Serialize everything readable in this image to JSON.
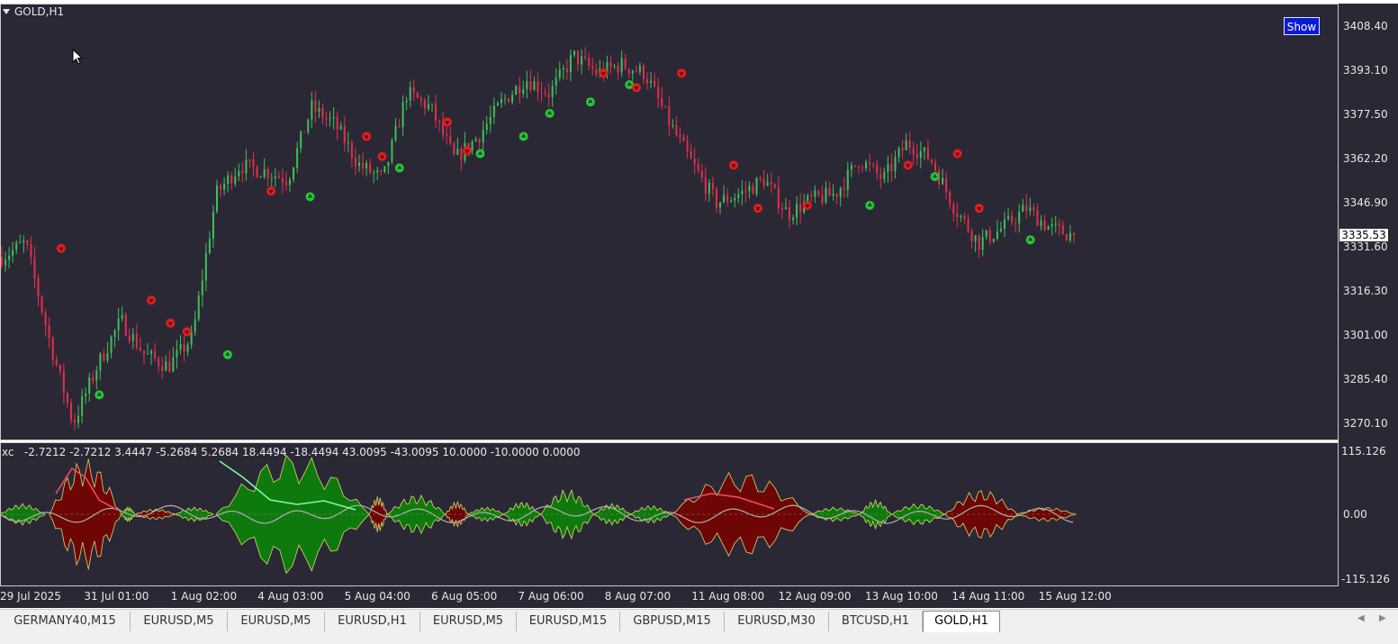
{
  "chart_title": "GOLD,H1",
  "show_button": "Show",
  "current_price": "3335.53",
  "price_axis": [
    "3408.40",
    "3393.10",
    "3377.50",
    "3362.20",
    "3346.90",
    "3331.60",
    "3316.30",
    "3301.00",
    "3285.40",
    "3270.10"
  ],
  "indicator": {
    "name": "xc",
    "values": "-2.7212 -2.7212 3.4447 -5.2684 5.2684 18.4494 -18.4494 43.0095 -43.0095 10.0000 -10.0000 0.0000",
    "axis": [
      "115.126",
      "0.00",
      "-115.126"
    ]
  },
  "time_axis": [
    "29 Jul 2025",
    "31 Jul 01:00",
    "1 Aug 02:00",
    "4 Aug 03:00",
    "5 Aug 04:00",
    "6 Aug 05:00",
    "7 Aug 06:00",
    "8 Aug 07:00",
    "11 Aug 08:00",
    "12 Aug 09:00",
    "13 Aug 10:00",
    "14 Aug 11:00",
    "15 Aug 12:00"
  ],
  "tabs": [
    "GERMANY40,M15",
    "EURUSD,M5",
    "EURUSD,M5",
    "EURUSD,H1",
    "EURUSD,M5",
    "EURUSD,M15",
    "GBPUSD,M15",
    "EURUSD,M30",
    "BTCUSD,H1",
    "GOLD,H1"
  ],
  "active_tab": "GOLD,H1",
  "colors": {
    "background": "#2b2836",
    "bull_candle": "#3fbf5a",
    "bear_candle": "#e0304a",
    "buy_arrow": "#28c23a",
    "sell_arrow": "#e01e1e",
    "fill_green": "#0e7a0e",
    "fill_red": "#6e0606",
    "show_button": "#0a1bd8"
  },
  "icons": [
    "dropdown-triangle-icon",
    "mouse-cursor-icon",
    "scroll-left-icon",
    "scroll-right-icon",
    "buy-arrow-icon",
    "sell-arrow-icon"
  ],
  "chart_data": {
    "type": "candlestick",
    "ylim": [
      3262,
      3412
    ],
    "x": [
      "29 Jul 2025",
      "31 Jul 01:00",
      "1 Aug 02:00",
      "4 Aug 03:00",
      "5 Aug 04:00",
      "6 Aug 05:00",
      "7 Aug 06:00",
      "8 Aug 07:00",
      "11 Aug 08:00",
      "12 Aug 09:00",
      "13 Aug 10:00",
      "14 Aug 11:00",
      "15 Aug 12:00"
    ],
    "path": [
      [
        "29 Jul 2025",
        3328
      ],
      [
        "30 Jul",
        3333
      ],
      [
        "30 Jul",
        3299
      ],
      [
        "31 Jul 01:00",
        3270
      ],
      [
        "31 Jul",
        3290
      ],
      [
        "31 Jul",
        3306
      ],
      [
        "1 Aug",
        3294
      ],
      [
        "1 Aug 02:00",
        3290
      ],
      [
        "1 Aug",
        3300
      ],
      [
        "1 Aug",
        3350
      ],
      [
        "1 Aug",
        3360
      ],
      [
        "4 Aug 03:00",
        3358
      ],
      [
        "4 Aug",
        3355
      ],
      [
        "4 Aug",
        3380
      ],
      [
        "5 Aug",
        3374
      ],
      [
        "5 Aug 04:00",
        3360
      ],
      [
        "5 Aug",
        3355
      ],
      [
        "5 Aug",
        3385
      ],
      [
        "6 Aug",
        3380
      ],
      [
        "6 Aug 05:00",
        3362
      ],
      [
        "6 Aug",
        3370
      ],
      [
        "7 Aug",
        3382
      ],
      [
        "7 Aug",
        3390
      ],
      [
        "7 Aug 06:00",
        3385
      ],
      [
        "8 Aug",
        3398
      ],
      [
        "8 Aug",
        3392
      ],
      [
        "8 Aug 07:00",
        3395
      ],
      [
        "8 Aug",
        3392
      ],
      [
        "8 Aug",
        3375
      ],
      [
        "11 Aug",
        3360
      ],
      [
        "11 Aug 08:00",
        3347
      ],
      [
        "11 Aug",
        3350
      ],
      [
        "12 Aug",
        3355
      ],
      [
        "12 Aug 09:00",
        3343
      ],
      [
        "12 Aug",
        3348
      ],
      [
        "13 Aug",
        3350
      ],
      [
        "13 Aug 10:00",
        3362
      ],
      [
        "13 Aug",
        3355
      ],
      [
        "13 Aug",
        3368
      ],
      [
        "14 Aug",
        3362
      ],
      [
        "14 Aug",
        3345
      ],
      [
        "14 Aug 11:00",
        3333
      ],
      [
        "14 Aug",
        3338
      ],
      [
        "15 Aug",
        3345
      ],
      [
        "15 Aug 12:00",
        3338
      ],
      [
        "15 Aug",
        3335.53
      ]
    ],
    "buy_signals": [
      [
        1.04,
        3280
      ],
      [
        2.52,
        3294
      ],
      [
        3.47,
        3349
      ],
      [
        4.5,
        3359
      ],
      [
        5.43,
        3364
      ],
      [
        5.93,
        3370
      ],
      [
        6.23,
        3378
      ],
      [
        6.7,
        3382
      ],
      [
        7.15,
        3388
      ],
      [
        9.92,
        3346
      ],
      [
        10.67,
        3356
      ],
      [
        11.77,
        3334
      ]
    ],
    "sell_signals": [
      [
        0.6,
        3331
      ],
      [
        1.64,
        3313
      ],
      [
        1.86,
        3305
      ],
      [
        2.05,
        3302
      ],
      [
        3.02,
        3351
      ],
      [
        4.12,
        3370
      ],
      [
        4.3,
        3363
      ],
      [
        5.05,
        3375
      ],
      [
        5.28,
        3365
      ],
      [
        6.85,
        3392
      ],
      [
        7.23,
        3387
      ],
      [
        7.75,
        3392
      ],
      [
        8.35,
        3360
      ],
      [
        8.63,
        3345
      ],
      [
        9.2,
        3346
      ],
      [
        10.36,
        3360
      ],
      [
        10.93,
        3364
      ],
      [
        11.18,
        3345
      ]
    ]
  }
}
